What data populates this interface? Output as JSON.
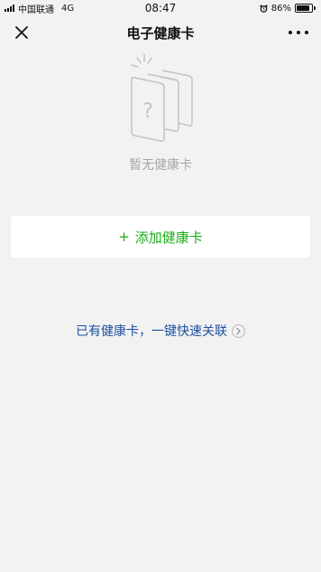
{
  "status_bar": {
    "carrier": "中国联通",
    "network": "4G",
    "time": "08:47",
    "battery_percent": "86%",
    "battery_level": 0.86
  },
  "nav": {
    "title": "电子健康卡"
  },
  "empty_state": {
    "text": "暂无健康卡"
  },
  "add_card": {
    "plus": "+",
    "label": "添加健康卡"
  },
  "quick_link": {
    "label": "已有健康卡，一键快速关联"
  },
  "colors": {
    "background": "#f2f2f2",
    "accent_green": "#1aad19",
    "link_blue": "#1f4fa0",
    "muted_text": "#a6a6a6"
  },
  "icons": {
    "close": "close-icon",
    "more": "more-icon",
    "empty": "empty-cards-icon",
    "chevron": "chevron-right-icon",
    "alarm": "alarm-icon"
  }
}
